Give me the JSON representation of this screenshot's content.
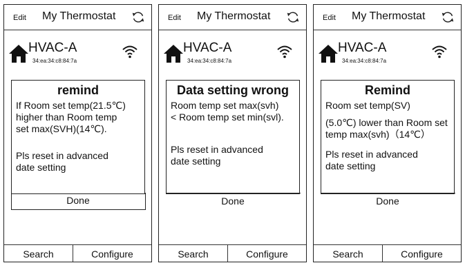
{
  "header": {
    "edit": "Edit",
    "title": "My Thermostat",
    "refresh_icon": "refresh-icon"
  },
  "device": {
    "name": "HVAC-A",
    "mac": "34:ea:34:c8:84:7a",
    "home_icon": "home-icon",
    "wifi_icon": "wifi-icon"
  },
  "footer": {
    "search": "Search",
    "configure": "Configure"
  },
  "screens": [
    {
      "title": "remind",
      "message": "If Room set temp(21.5℃)\nhigher than Room temp\nset max(SVH)(14℃).",
      "message2": "Pls reset in advanced\ndate setting",
      "done": "Done"
    },
    {
      "title": "Data setting wrong",
      "message": "Room temp set max(svh)\n< Room temp set min(svl).",
      "message2": "Pls reset in advanced\ndate setting",
      "done": "Done"
    },
    {
      "title": "Remind",
      "message": "Room set temp(SV)",
      "message_b": "(5.0℃) lower than Room set temp max(svh)（14℃）",
      "message2": "Pls reset in advanced\ndate setting",
      "done": "Done"
    }
  ]
}
